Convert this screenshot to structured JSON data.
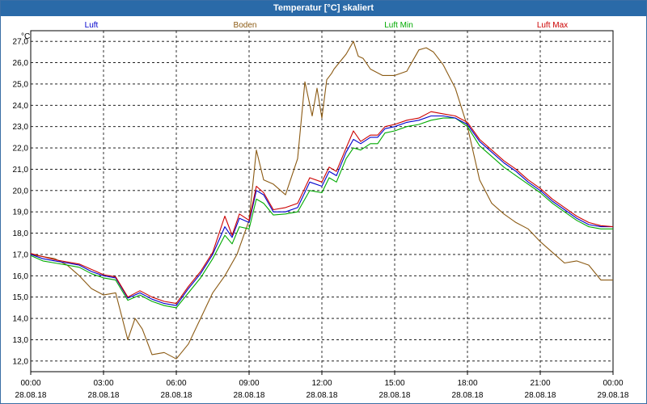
{
  "window": {
    "title": "Temperatur [°C] skaliert"
  },
  "chart_data": {
    "type": "line",
    "title": "Temperatur [°C] skaliert",
    "ylabel": "°C",
    "xlabel": "",
    "ylim": [
      11.5,
      27.5
    ],
    "xlim": [
      0,
      24
    ],
    "grid": true,
    "legend_position": "top",
    "y_ticks": [
      "12,0",
      "13,0",
      "14,0",
      "15,0",
      "16,0",
      "17,0",
      "18,0",
      "19,0",
      "20,0",
      "21,0",
      "22,0",
      "23,0",
      "24,0",
      "25,0",
      "26,0",
      "27,0"
    ],
    "x_ticks": [
      {
        "time": "00:00",
        "date": "28.08.18"
      },
      {
        "time": "03:00",
        "date": "28.08.18"
      },
      {
        "time": "06:00",
        "date": "28.08.18"
      },
      {
        "time": "09:00",
        "date": "28.08.18"
      },
      {
        "time": "12:00",
        "date": "28.08.18"
      },
      {
        "time": "15:00",
        "date": "28.08.18"
      },
      {
        "time": "18:00",
        "date": "28.08.18"
      },
      {
        "time": "21:00",
        "date": "28.08.18"
      },
      {
        "time": "00:00",
        "date": "29.08.18"
      }
    ],
    "series": [
      {
        "name": "Luft",
        "color": "#0000cc",
        "x": [
          0,
          0.5,
          1,
          1.5,
          2,
          2.5,
          3,
          3.5,
          4,
          4.5,
          5,
          5.5,
          6,
          6.5,
          7,
          7.5,
          8,
          8.3,
          8.6,
          9,
          9.3,
          9.6,
          10,
          10.5,
          11,
          11.5,
          12,
          12.3,
          12.6,
          13,
          13.3,
          13.6,
          14,
          14.3,
          14.6,
          15,
          15.5,
          16,
          16.5,
          17,
          17.5,
          18,
          18.5,
          19,
          19.5,
          20,
          20.5,
          21,
          21.5,
          22,
          22.5,
          23,
          23.5,
          24
        ],
        "y": [
          17.0,
          16.8,
          16.7,
          16.6,
          16.5,
          16.2,
          16.0,
          15.9,
          14.95,
          15.2,
          14.9,
          14.7,
          14.6,
          15.4,
          16.1,
          17.0,
          18.3,
          17.8,
          18.7,
          18.5,
          20.0,
          19.8,
          19.0,
          19.0,
          19.2,
          20.4,
          20.2,
          20.9,
          20.7,
          21.8,
          22.4,
          22.2,
          22.5,
          22.5,
          22.9,
          23.0,
          23.2,
          23.3,
          23.5,
          23.5,
          23.4,
          23.1,
          22.3,
          21.8,
          21.3,
          20.9,
          20.4,
          20.0,
          19.5,
          19.1,
          18.7,
          18.4,
          18.3,
          18.3
        ]
      },
      {
        "name": "Boden",
        "color": "#8b5a13",
        "x": [
          0,
          0.5,
          1,
          1.5,
          2,
          2.5,
          3,
          3.5,
          4,
          4.3,
          4.6,
          5,
          5.5,
          6,
          6.5,
          7,
          7.5,
          8,
          8.5,
          9,
          9.3,
          9.6,
          10,
          10.5,
          11,
          11.3,
          11.6,
          11.8,
          12,
          12.2,
          12.4,
          12.5,
          13,
          13.3,
          13.5,
          13.7,
          14,
          14.5,
          15,
          15.5,
          16,
          16.3,
          16.6,
          17,
          17.5,
          18,
          18.5,
          19,
          19.5,
          20,
          20.5,
          21,
          21.5,
          22,
          22.5,
          23,
          23.5,
          24
        ],
        "y": [
          17.0,
          16.9,
          16.8,
          16.5,
          16.0,
          15.4,
          15.1,
          15.2,
          13.0,
          14.0,
          13.5,
          12.3,
          12.4,
          12.1,
          12.8,
          14.0,
          15.2,
          16.0,
          17.0,
          18.6,
          21.9,
          20.5,
          20.3,
          19.8,
          21.5,
          25.1,
          23.5,
          24.8,
          23.4,
          25.2,
          25.5,
          25.7,
          26.4,
          27.0,
          26.3,
          26.2,
          25.7,
          25.4,
          25.4,
          25.6,
          26.6,
          26.7,
          26.5,
          25.9,
          24.8,
          23.0,
          20.5,
          19.4,
          18.9,
          18.5,
          18.2,
          17.6,
          17.1,
          16.6,
          16.7,
          16.5,
          15.8,
          15.8
        ]
      },
      {
        "name": "Luft Min",
        "color": "#00aa00",
        "x": [
          0,
          0.5,
          1,
          1.5,
          2,
          2.5,
          3,
          3.5,
          4,
          4.5,
          5,
          5.5,
          6,
          6.5,
          7,
          7.5,
          8,
          8.3,
          8.6,
          9,
          9.3,
          9.6,
          10,
          10.5,
          11,
          11.5,
          12,
          12.3,
          12.6,
          13,
          13.3,
          13.6,
          14,
          14.3,
          14.6,
          15,
          15.5,
          16,
          16.5,
          17,
          17.5,
          18,
          18.5,
          19,
          19.5,
          20,
          20.5,
          21,
          21.5,
          22,
          22.5,
          23,
          23.5,
          24
        ],
        "y": [
          16.95,
          16.7,
          16.6,
          16.5,
          16.4,
          16.1,
          15.9,
          15.8,
          14.85,
          15.1,
          14.8,
          14.6,
          14.5,
          15.2,
          15.9,
          16.8,
          17.9,
          17.5,
          18.3,
          18.2,
          19.6,
          19.4,
          18.85,
          18.9,
          19.0,
          20.0,
          19.9,
          20.6,
          20.4,
          21.5,
          22.0,
          21.9,
          22.2,
          22.2,
          22.7,
          22.8,
          23.0,
          23.1,
          23.3,
          23.4,
          23.4,
          23.0,
          22.1,
          21.6,
          21.1,
          20.7,
          20.3,
          19.9,
          19.4,
          19.0,
          18.6,
          18.3,
          18.2,
          18.2
        ]
      },
      {
        "name": "Luft Max",
        "color": "#cc0000",
        "x": [
          0,
          0.5,
          1,
          1.5,
          2,
          2.5,
          3,
          3.5,
          4,
          4.5,
          5,
          5.5,
          6,
          6.5,
          7,
          7.5,
          8,
          8.3,
          8.6,
          9,
          9.3,
          9.6,
          10,
          10.5,
          11,
          11.5,
          12,
          12.3,
          12.6,
          13,
          13.3,
          13.6,
          14,
          14.3,
          14.6,
          15,
          15.5,
          16,
          16.5,
          17,
          17.5,
          18,
          18.5,
          19,
          19.5,
          20,
          20.5,
          21,
          21.5,
          22,
          22.5,
          23,
          23.5,
          24
        ],
        "y": [
          17.05,
          16.9,
          16.75,
          16.65,
          16.55,
          16.3,
          16.05,
          15.95,
          15.0,
          15.3,
          15.0,
          14.8,
          14.7,
          15.5,
          16.2,
          17.1,
          18.8,
          17.9,
          18.9,
          18.6,
          20.2,
          19.9,
          19.1,
          19.2,
          19.4,
          20.6,
          20.4,
          21.1,
          20.9,
          22.0,
          22.8,
          22.3,
          22.6,
          22.6,
          23.0,
          23.1,
          23.3,
          23.4,
          23.7,
          23.6,
          23.5,
          23.2,
          22.4,
          21.9,
          21.4,
          21.0,
          20.5,
          20.1,
          19.6,
          19.2,
          18.8,
          18.5,
          18.35,
          18.3
        ]
      }
    ]
  }
}
